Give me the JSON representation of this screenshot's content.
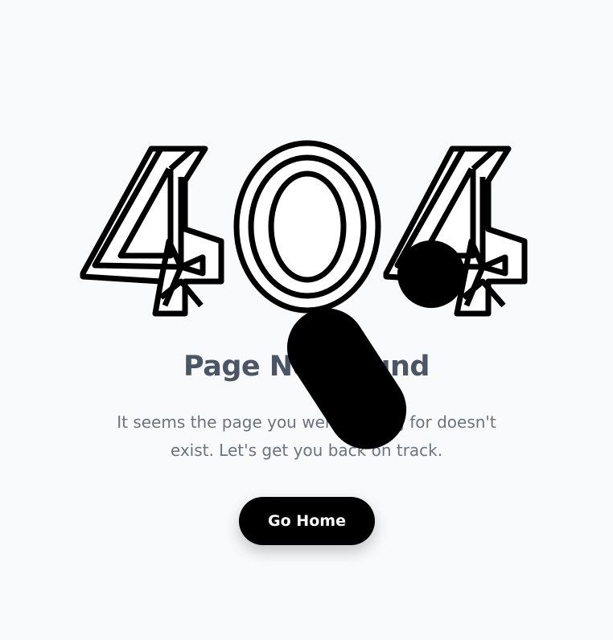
{
  "error": {
    "code": "404",
    "title": "Page Not Found",
    "description": "It seems the page you were looking for doesn't exist. Let's get you back on track."
  },
  "actions": {
    "home_label": "Go Home"
  },
  "colors": {
    "background": "#f9fafb",
    "title": "#4b5563",
    "description": "#6b7280",
    "button": "#000000",
    "button_text": "#ffffff"
  }
}
